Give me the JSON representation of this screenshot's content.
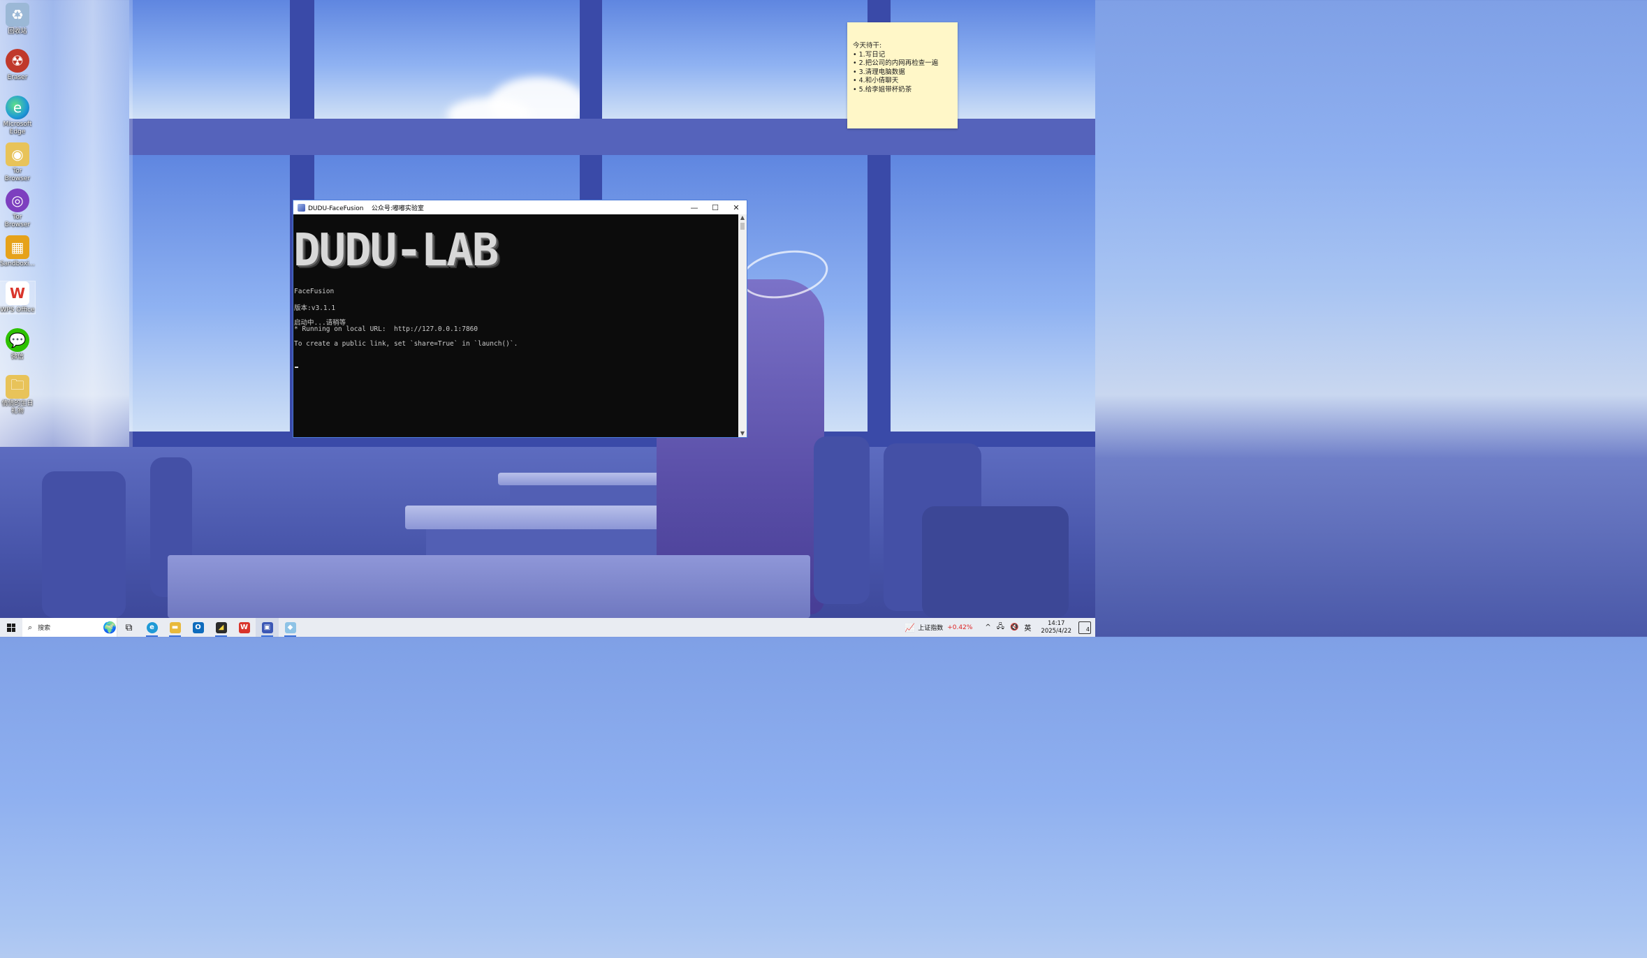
{
  "desktop": {
    "icons": [
      {
        "label": "回收站",
        "icon": "recycle-bin-icon",
        "color": "#9bb8d6"
      },
      {
        "label": "Eraser",
        "icon": "eraser-icon",
        "color": "#c0392b"
      },
      {
        "label": "Microsoft Edge",
        "icon": "edge-icon",
        "color": "#1f9ad6"
      },
      {
        "label": "Tor Browser",
        "icon": "tor-folder-icon",
        "color": "#e8c35a"
      },
      {
        "label": "Tor Browser",
        "icon": "tor-browser-icon",
        "color": "#7d3fbf"
      },
      {
        "label": "Sandboxi...",
        "icon": "sandboxie-icon",
        "color": "#e6a21a"
      },
      {
        "label": "WPS Office",
        "icon": "wps-icon",
        "color": "#d9342b"
      },
      {
        "label": "微信",
        "icon": "wechat-icon",
        "color": "#2dc100"
      },
      {
        "label": "倩倩的生日礼物",
        "icon": "folder-icon",
        "color": "#e8c35a"
      }
    ]
  },
  "note": {
    "title": "今天待干:",
    "items": [
      "1.写日记",
      "2.把公司的内网再检查一遍",
      "3.清理电脑数据",
      "4.和小倩聊天",
      "5.给李姐带杯奶茶"
    ]
  },
  "window": {
    "title": "DUDU-FaceFusion    公众号:嘟嘟实验室",
    "minimize": "—",
    "maximize": "☐",
    "close": "✕",
    "banner": "DUDU-LAB",
    "lines": [
      "FaceFusion",
      "版本:v3.1.1",
      "启动中...请稍等",
      "* Running on local URL:  http://127.0.0.1:7860",
      "To create a public link, set `share=True` in `launch()`."
    ]
  },
  "taskbar": {
    "search_placeholder": "搜索",
    "stock_name": "上证指数",
    "stock_change": "+0.42%",
    "ime": "英",
    "time": "14:17",
    "date": "2025/4/22",
    "notifications": "4"
  }
}
